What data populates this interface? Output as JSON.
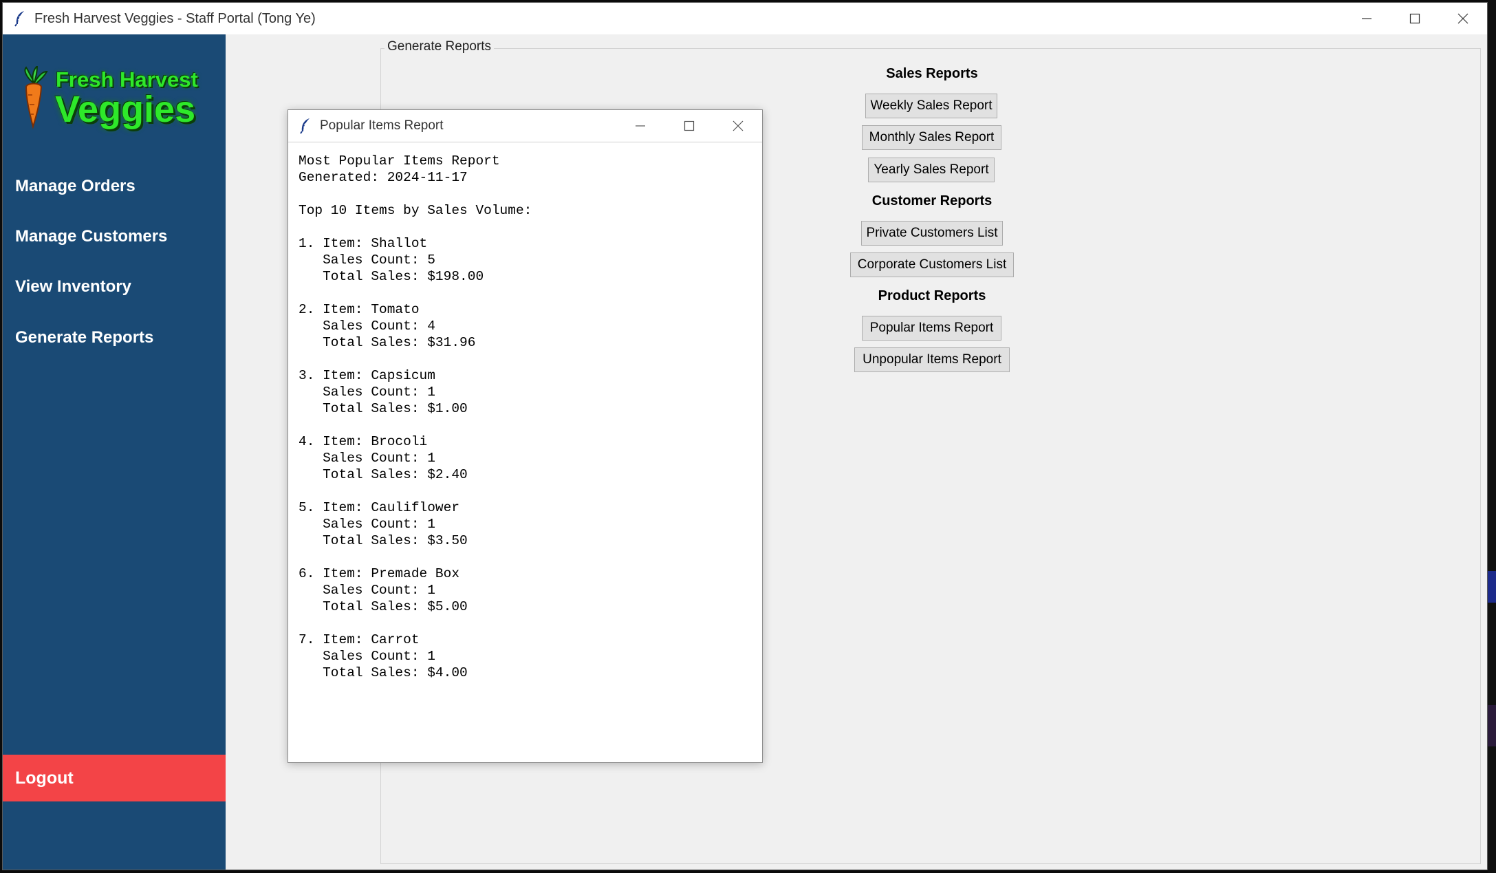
{
  "window": {
    "title": "Fresh Harvest Veggies - Staff Portal (Tong Ye)"
  },
  "sidebar": {
    "logo": {
      "line1": "Fresh Harvest",
      "line2": "Veggies"
    },
    "items": [
      {
        "label": "Manage Orders"
      },
      {
        "label": "Manage Customers"
      },
      {
        "label": "View Inventory"
      },
      {
        "label": "Generate Reports"
      }
    ],
    "logout_label": "Logout"
  },
  "main": {
    "frame_label": "Generate Reports",
    "sections": [
      {
        "heading": "Sales Reports",
        "buttons": [
          "Weekly Sales Report",
          "Monthly Sales Report",
          "Yearly Sales Report"
        ]
      },
      {
        "heading": "Customer Reports",
        "buttons": [
          "Private Customers List",
          "Corporate Customers List"
        ]
      },
      {
        "heading": "Product Reports",
        "buttons": [
          "Popular Items Report",
          "Unpopular Items Report"
        ]
      }
    ]
  },
  "popup": {
    "title": "Popular Items Report",
    "header_lines": [
      "Most Popular Items Report",
      "Generated: 2024-11-17",
      "",
      "Top 10 Items by Sales Volume:"
    ],
    "items": [
      {
        "rank": "1.",
        "item": "Item: Shallot",
        "count": "Sales Count: 5",
        "total": "Total Sales: $198.00"
      },
      {
        "rank": "2.",
        "item": "Item: Tomato",
        "count": "Sales Count: 4",
        "total": "Total Sales: $31.96"
      },
      {
        "rank": "3.",
        "item": "Item: Capsicum",
        "count": "Sales Count: 1",
        "total": "Total Sales: $1.00"
      },
      {
        "rank": "4.",
        "item": "Item: Brocoli",
        "count": "Sales Count: 1",
        "total": "Total Sales: $2.40"
      },
      {
        "rank": "5.",
        "item": "Item: Cauliflower",
        "count": "Sales Count: 1",
        "total": "Total Sales: $3.50"
      },
      {
        "rank": "6.",
        "item": "Item: Premade Box",
        "count": "Sales Count: 1",
        "total": "Total Sales: $5.00"
      },
      {
        "rank": "7.",
        "item": "Item: Carrot",
        "count": "Sales Count: 1",
        "total": "Total Sales: $4.00"
      }
    ]
  },
  "colors": {
    "sidebar_bg": "#1a4a75",
    "logout_bg": "#f34447",
    "logo_green": "#2ee82a",
    "content_bg": "#f0f0f0"
  },
  "icons": {
    "app": "feather-icon",
    "minimize": "minimize-icon",
    "maximize": "maximize-icon",
    "close": "close-icon",
    "logo": "carrot-icon"
  }
}
